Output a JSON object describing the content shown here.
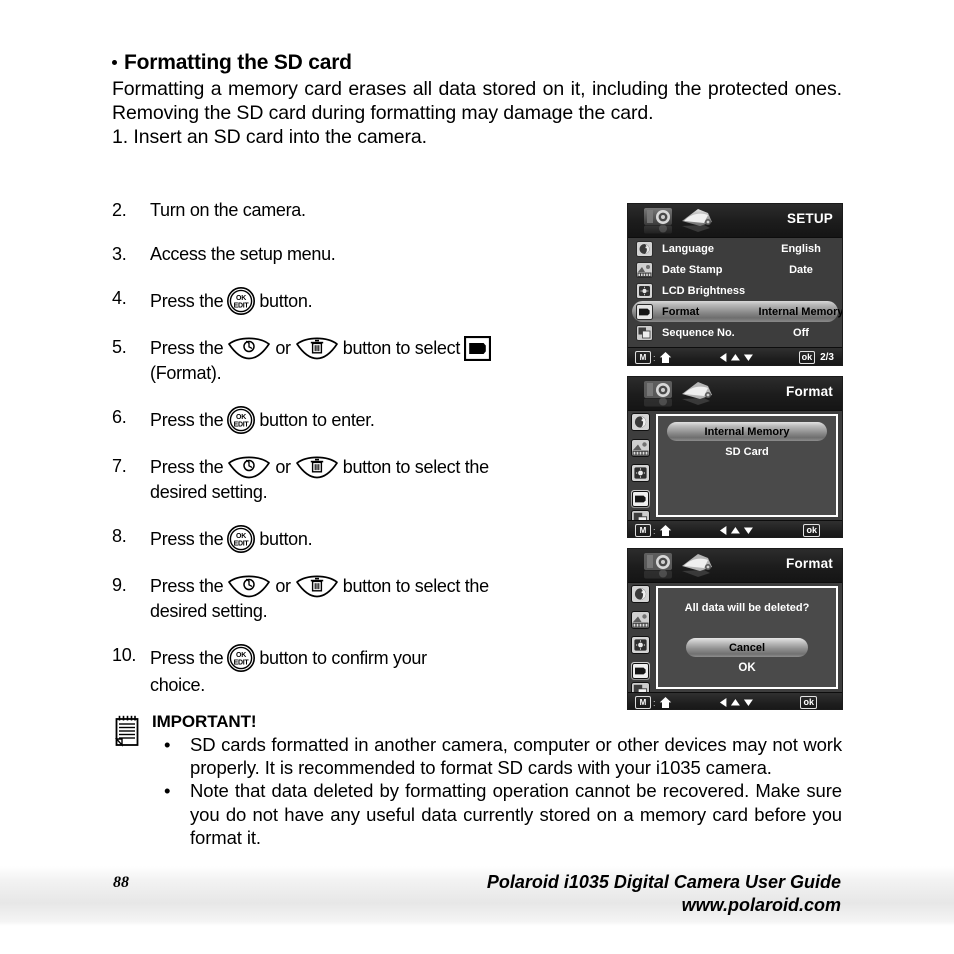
{
  "heading": "Formatting the SD card",
  "intro": "Formatting a memory card erases all data stored on it, including the protected ones. Removing the SD card during formatting may damage the card.",
  "step1": "1.  Insert an SD card into the camera.",
  "steps": [
    {
      "num": "2.",
      "before": "Turn on the camera.",
      "after": "",
      "tail": "",
      "icons": []
    },
    {
      "num": "3.",
      "before": "Access the setup menu.",
      "after": "",
      "tail": "",
      "icons": []
    },
    {
      "num": "4.",
      "before": "Press the",
      "mid": "",
      "after": "button.",
      "tail": "",
      "icons": [
        "ok-edit"
      ]
    },
    {
      "num": "5.",
      "before": "Press the",
      "mid": "or",
      "after": "button to select",
      "tail": "(Format).",
      "icons": [
        "self-timer",
        "delete"
      ]
    },
    {
      "num": "6.",
      "before": "Press the",
      "mid": "",
      "after": "button to enter.",
      "tail": "",
      "icons": [
        "ok-edit"
      ]
    },
    {
      "num": "7.",
      "before": "Press the",
      "mid": "or",
      "after": "button to select the",
      "tail": "desired setting.",
      "icons": [
        "self-timer",
        "delete"
      ]
    },
    {
      "num": "8.",
      "before": "Press the",
      "mid": "",
      "after": "button.",
      "tail": "",
      "icons": [
        "ok-edit"
      ]
    },
    {
      "num": "9.",
      "before": "Press the",
      "mid": "or",
      "after": "button to select the",
      "tail": "desired setting.",
      "icons": [
        "self-timer",
        "delete"
      ]
    },
    {
      "num": "10.",
      "before": "Press  the",
      "mid": "",
      "after": "button  to  confirm  your",
      "tail": "choice.",
      "icons": [
        "ok-edit"
      ]
    }
  ],
  "button_labels": {
    "ok_top": "OK",
    "ok_bottom": "EDIT"
  },
  "screens": [
    {
      "id": "setup-menu",
      "title": "SETUP",
      "rows": [
        {
          "icon": "language-icon",
          "label": "Language",
          "value": "English",
          "selected": false
        },
        {
          "icon": "date-stamp-icon",
          "label": "Date Stamp",
          "value": "Date",
          "selected": false
        },
        {
          "icon": "brightness-icon",
          "label": "LCD Brightness",
          "value": "",
          "selected": false
        },
        {
          "icon": "format-icon",
          "label": "Format",
          "value": "Internal Memory",
          "selected": true
        },
        {
          "icon": "sequence-icon",
          "label": "Sequence No.",
          "value": "Off",
          "selected": false
        }
      ],
      "footer": {
        "mode": "M",
        "ok": "ok",
        "page": "2/3"
      }
    },
    {
      "id": "format-options",
      "title": "Format",
      "options": [
        {
          "label": "Internal Memory",
          "selected": true
        },
        {
          "label": "SD Card",
          "selected": false
        }
      ],
      "footer": {
        "mode": "M",
        "ok": "ok",
        "page": ""
      }
    },
    {
      "id": "format-confirm",
      "title": "Format",
      "message": "All data will be deleted?",
      "buttons": [
        {
          "label": "Cancel",
          "selected": true
        },
        {
          "label": "OK",
          "selected": false
        }
      ],
      "footer": {
        "mode": "M",
        "ok": "ok",
        "page": ""
      }
    }
  ],
  "important": {
    "title": "IMPORTANT!",
    "items": [
      "SD cards formatted in another camera, computer or other devices may not work properly. It is recommended to format SD cards with your i1035 camera.",
      "Note that data deleted by formatting operation cannot be recovered. Make sure you do not have any useful data currently stored on a memory card before you format it."
    ]
  },
  "footer": {
    "page_number": "88",
    "line1": "Polaroid i1035 Digital Camera User Guide",
    "line2": "www.polaroid.com"
  }
}
